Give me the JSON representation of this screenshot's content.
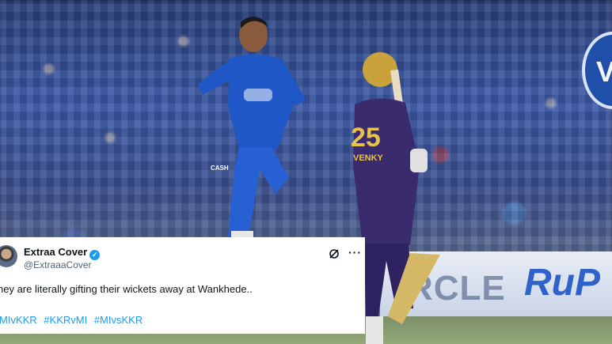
{
  "photo": {
    "board_text": "RCLE",
    "board_brand": "RuP",
    "logo_letter": "V",
    "bowler": {
      "jersey_badge": "CASH"
    },
    "batter": {
      "number": "25",
      "name": "VENKY"
    }
  },
  "tweet": {
    "display_name": "Extraa Cover",
    "verified": true,
    "handle": "@ExtraaaCover",
    "text": "hey are literally gifting their wickets away at Wankhede..",
    "hashtags": [
      "#MIvKKR",
      "#KKRvMI",
      "#MIvsKKR"
    ],
    "hashtags_visible": [
      "MIvKKR",
      "#KKRvMI",
      "#MIvsKKR"
    ],
    "icons": [
      "grok-icon",
      "more-icon"
    ]
  }
}
